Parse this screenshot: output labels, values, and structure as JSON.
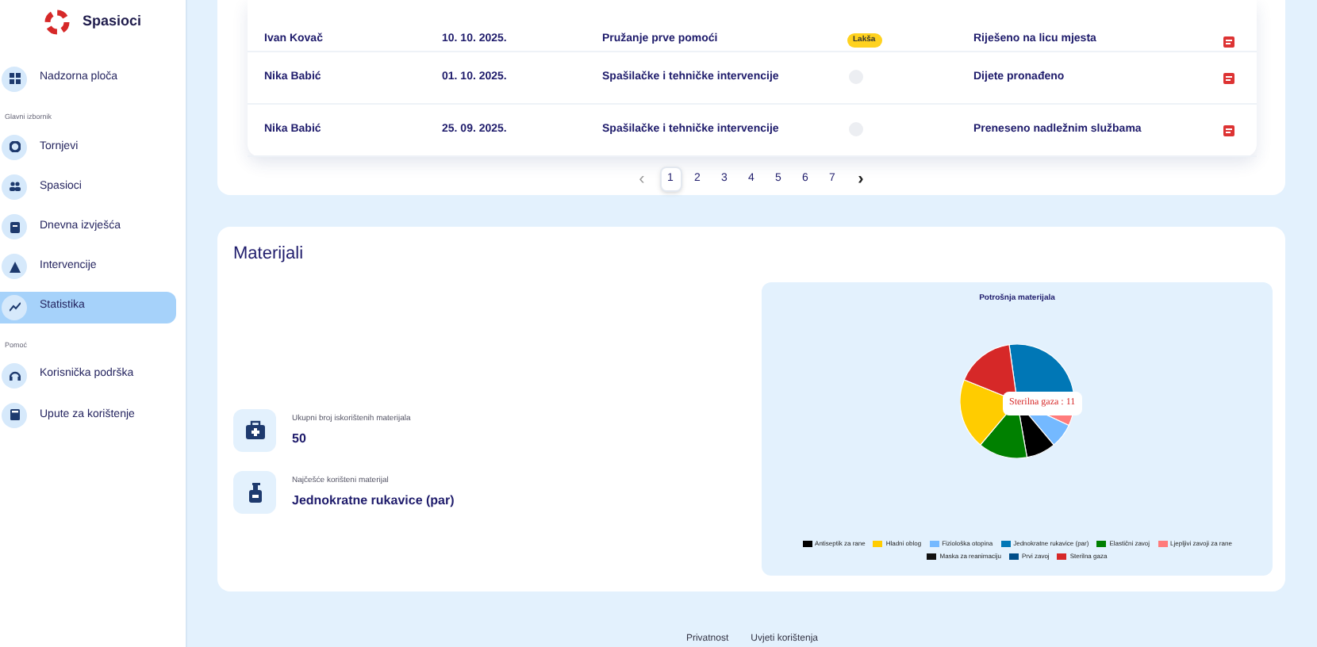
{
  "brand": {
    "name": "Spasioci"
  },
  "sidebar": {
    "items": [
      {
        "kind": "link",
        "label": "Nadzorna ploča",
        "selected": false
      },
      {
        "kind": "section",
        "label": "Glavni izbornik"
      },
      {
        "kind": "link",
        "label": "Tornjevi",
        "selected": false
      },
      {
        "kind": "link",
        "label": "Spasioci",
        "selected": false
      },
      {
        "kind": "link",
        "label": "Dnevna izvješća",
        "selected": false
      },
      {
        "kind": "link",
        "label": "Intervencije",
        "selected": false
      },
      {
        "kind": "link",
        "label": "Statistika",
        "selected": true
      },
      {
        "kind": "section",
        "label": "Pomoć"
      },
      {
        "kind": "link",
        "label": "Korisnička podrška",
        "selected": false
      },
      {
        "kind": "link",
        "label": "Upute za korištenje",
        "selected": false
      }
    ]
  },
  "table": {
    "rows": [
      {
        "rescuer": "Ivan Kovač",
        "date": "10. 10. 2025.",
        "type": "Pružanje prve pomoći",
        "status": {
          "kind": "badge",
          "label": "Lakša"
        },
        "outcome": "Riješeno na licu mjesta"
      },
      {
        "rescuer": "Nika Babić",
        "date": "01. 10. 2025.",
        "type": "Spašilačke i tehničke intervencije",
        "status": {
          "kind": "empty"
        },
        "outcome": "Dijete pronađeno"
      },
      {
        "rescuer": "Nika Babić",
        "date": "25. 09. 2025.",
        "type": "Spašilačke i tehničke intervencije",
        "status": {
          "kind": "empty"
        },
        "outcome": "Preneseno nadležnim službama"
      }
    ],
    "pagination": {
      "prev": "‹",
      "next": "›",
      "pages": [
        {
          "label": "1",
          "selected": true
        },
        {
          "label": "2",
          "selected": false
        },
        {
          "label": "3",
          "selected": false
        },
        {
          "label": "4",
          "selected": false
        },
        {
          "label": "5",
          "selected": false
        },
        {
          "label": "6",
          "selected": false
        },
        {
          "label": "7",
          "selected": false
        }
      ]
    }
  },
  "materials": {
    "title": "Materijali",
    "stats": [
      {
        "label": "Ukupni broj iskorištenih materijala",
        "value": "50"
      },
      {
        "label": "Najčešće korišteni materijal",
        "value": "Jednokratne rukavice (par)"
      }
    ],
    "chart": {
      "title": "Potrošnja materijala",
      "tooltip": "Sterilna gaza : 11",
      "legend": [
        {
          "label": "Antiseptik za rane",
          "color": "#000000"
        },
        {
          "label": "Hladni oblog",
          "color": "#ffcc00"
        },
        {
          "label": "Fiziološka otopina",
          "color": "#74b9ff"
        },
        {
          "label": "Jednokratne rukavice (par)",
          "color": "#0077b6"
        },
        {
          "label": "Elastični zavoj",
          "color": "#008000"
        },
        {
          "label": "Ljepljivi zavoji za rane",
          "color": "#ff7b7b"
        },
        {
          "label": "Maska za reanimaciju",
          "color": "#111111"
        },
        {
          "label": "Prvi zavoj",
          "color": "#004e89"
        },
        {
          "label": "Sterilna gaza",
          "color": "#d62828"
        }
      ]
    }
  },
  "footer": {
    "links": [
      "Privatnost",
      "Uvjeti korištenja"
    ]
  }
}
